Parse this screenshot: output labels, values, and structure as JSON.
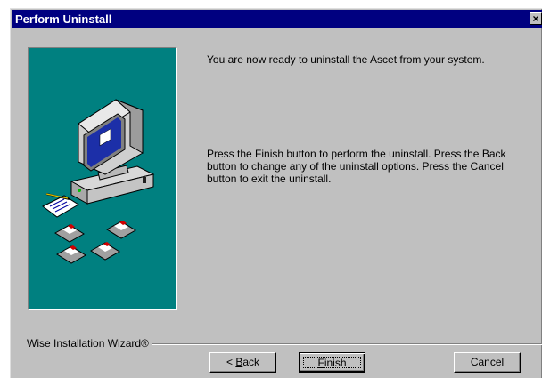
{
  "window": {
    "title": "Perform Uninstall",
    "close_label": "×"
  },
  "content": {
    "message1": "You are now ready to uninstall the Ascet from your system.",
    "message2": "Press the Finish button to perform the uninstall. Press the Back button to change any of the uninstall options. Press the Cancel button to exit the uninstall."
  },
  "footer": {
    "brand": "Wise Installation Wizard®"
  },
  "buttons": {
    "back": {
      "prefix": "< ",
      "mnemonic": "B",
      "rest": "ack"
    },
    "finish": {
      "mnemonic": "F",
      "rest": "inish"
    },
    "cancel": "Cancel"
  },
  "colors": {
    "titlebar": "#000080",
    "face": "#c0c0c0",
    "art_background": "#008080"
  },
  "icons": [
    "close-icon",
    "computer-illustration",
    "floppy-disk-icon"
  ]
}
